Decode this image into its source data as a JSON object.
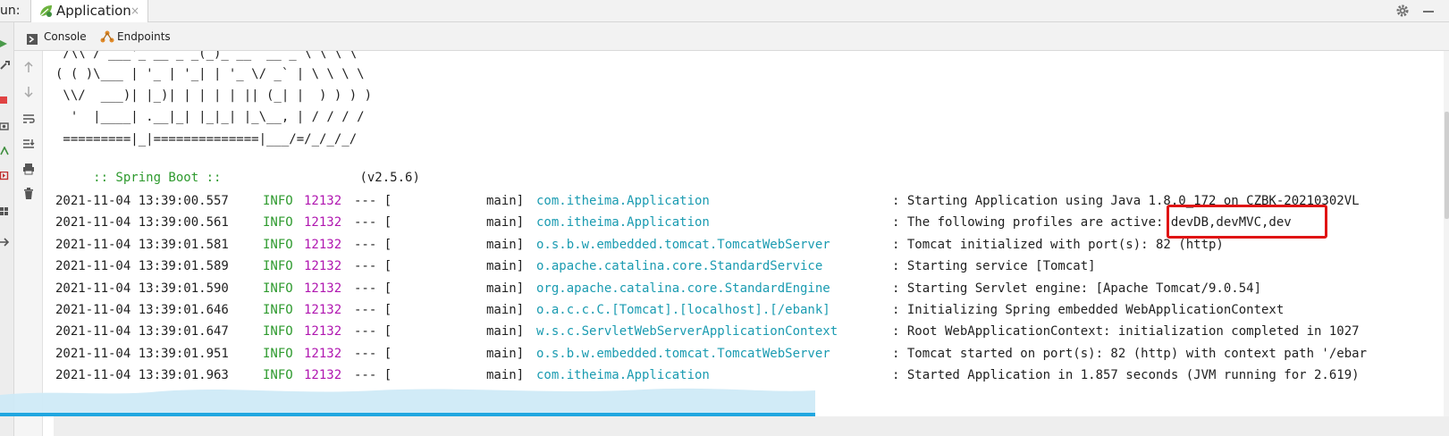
{
  "run_bar": {
    "label": "un:",
    "tab_title": "Application",
    "close_glyph": "×"
  },
  "tool_tabs": [
    {
      "label": "Console",
      "icon": "console-icon"
    },
    {
      "label": "Endpoints",
      "icon": "endpoints-icon"
    }
  ],
  "banner": {
    "lines": [
      " /\\\\ / ___'_ __ _ _(_)_ __  __ _ \\ \\ \\ \\",
      "( ( )\\___ | '_ | '_| | '_ \\/ _` | \\ \\ \\ \\",
      " \\\\/  ___)| |_)| | | | | || (_| |  ) ) ) )",
      "  '  |____| .__|_| |_|_| |_\\__, | / / / /",
      " =========|_|==============|___/=/_/_/_/"
    ],
    "spring_label": " :: Spring Boot ::",
    "version": "(v2.5.6)"
  },
  "log_rows": [
    {
      "ts": "2021-11-04 13:39:00.557",
      "level": "INFO",
      "pid": "12132",
      "sep": "--- [",
      "thread": "main]",
      "logger": "com.itheima.Application",
      "message": ": Starting Application using Java 1.8.0_172 on CZBK-20210302VL"
    },
    {
      "ts": "2021-11-04 13:39:00.561",
      "level": "INFO",
      "pid": "12132",
      "sep": "--- [",
      "thread": "main]",
      "logger": "com.itheima.Application",
      "message": ": The following profiles are active: devDB,devMVC,dev"
    },
    {
      "ts": "2021-11-04 13:39:01.581",
      "level": "INFO",
      "pid": "12132",
      "sep": "--- [",
      "thread": "main]",
      "logger": "o.s.b.w.embedded.tomcat.TomcatWebServer",
      "message": ": Tomcat initialized with port(s): 82 (http)"
    },
    {
      "ts": "2021-11-04 13:39:01.589",
      "level": "INFO",
      "pid": "12132",
      "sep": "--- [",
      "thread": "main]",
      "logger": "o.apache.catalina.core.StandardService",
      "message": ": Starting service [Tomcat]"
    },
    {
      "ts": "2021-11-04 13:39:01.590",
      "level": "INFO",
      "pid": "12132",
      "sep": "--- [",
      "thread": "main]",
      "logger": "org.apache.catalina.core.StandardEngine",
      "message": ": Starting Servlet engine: [Apache Tomcat/9.0.54]"
    },
    {
      "ts": "2021-11-04 13:39:01.646",
      "level": "INFO",
      "pid": "12132",
      "sep": "--- [",
      "thread": "main]",
      "logger": "o.a.c.c.C.[Tomcat].[localhost].[/ebank]",
      "message": ": Initializing Spring embedded WebApplicationContext"
    },
    {
      "ts": "2021-11-04 13:39:01.647",
      "level": "INFO",
      "pid": "12132",
      "sep": "--- [",
      "thread": "main]",
      "logger": "w.s.c.ServletWebServerApplicationContext",
      "message": ": Root WebApplicationContext: initialization completed in 1027"
    },
    {
      "ts": "2021-11-04 13:39:01.951",
      "level": "INFO",
      "pid": "12132",
      "sep": "--- [",
      "thread": "main]",
      "logger": "o.s.b.w.embedded.tomcat.TomcatWebServer",
      "message": ": Tomcat started on port(s): 82 (http) with context path '/ebar"
    },
    {
      "ts": "2021-11-04 13:39:01.963",
      "level": "INFO",
      "pid": "12132",
      "sep": "--- [",
      "thread": "main]",
      "logger": "com.itheima.Application",
      "message": ": Started Application in 1.857 seconds (JVM running for 2.619)"
    }
  ],
  "colors": {
    "level": "#2e9a2e",
    "pid": "#b016b0",
    "logger": "#1a9bb1",
    "highlight": "#e01414",
    "spring": "#2e9a2e"
  }
}
